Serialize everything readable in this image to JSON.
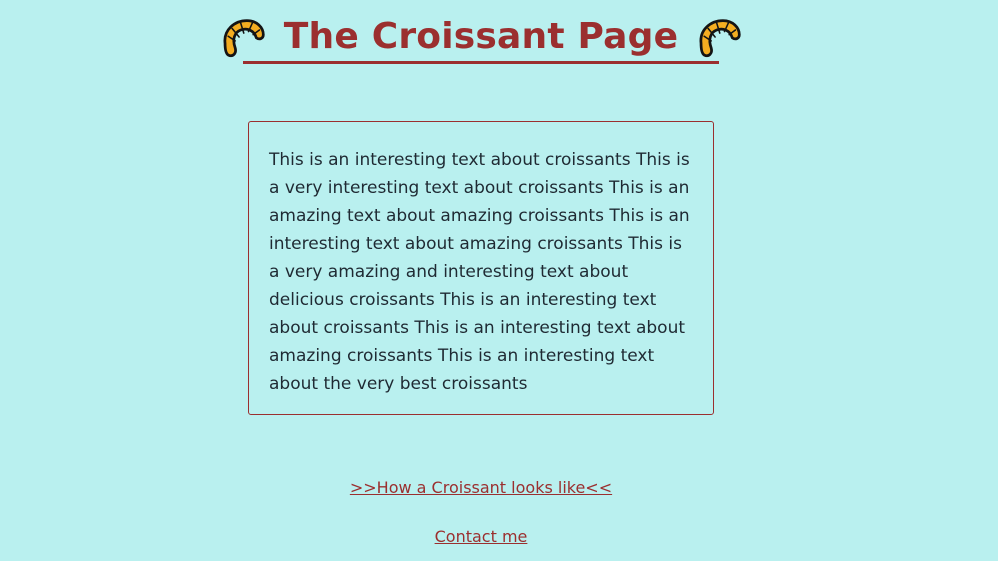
{
  "header": {
    "title": "The Croissant Page",
    "left_icon": "croissant-icon",
    "right_icon": "croissant-icon",
    "title_color": "#9b2f2f"
  },
  "content": {
    "paragraph": "This is an interesting text about croissants This is a very interesting text about croissants This is an amazing text about amazing croissants This is an interesting text about amazing croissants This is a very amazing and interesting text about delicious croissants This is an interesting text about croissants This is an interesting text about amazing croissants This is an interesting text about the very best croissants"
  },
  "links": {
    "croissant_looks": ">>How a Croissant looks like<<",
    "contact": "Contact me"
  },
  "theme": {
    "background": "#b9f0ef",
    "accent": "#9b2f2f",
    "text": "#1f2a33"
  }
}
